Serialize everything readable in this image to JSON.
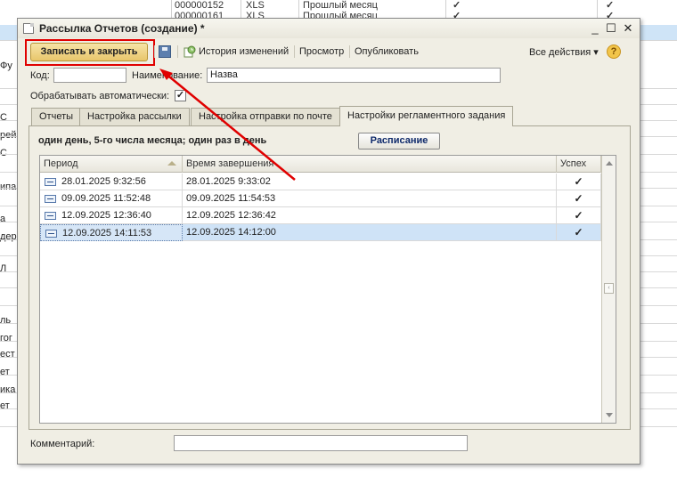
{
  "background": {
    "top_row": {
      "col1": "000000152",
      "col2": "XLS",
      "col3": "Прошлый месяц"
    },
    "second_row": {
      "col1": "000000161",
      "col2": "XLS",
      "col3": "Прошлый месяц"
    },
    "left_fragments": [
      "Фу",
      "С",
      "рей,",
      "С",
      "ипа",
      "а",
      "дер",
      "Л",
      "ль",
      "гог",
      "ест",
      "ет",
      "ика",
      "ет"
    ]
  },
  "dialog": {
    "title": "Рассылка Отчетов (создание) *",
    "window_buttons": {
      "minimize": "_",
      "maximize": "☐",
      "close": "✕"
    },
    "toolbar": {
      "save_close_label": "Записать и закрыть",
      "history_label": "История изменений",
      "preview_label": "Просмотр",
      "publish_label": "Опубликовать",
      "all_actions_label": "Все действия ▾",
      "help_label": "?"
    },
    "fields": {
      "code_label": "Код:",
      "code_value": "",
      "name_label": "Наименование:",
      "name_value": "Назва",
      "auto_label": "Обрабатывать автоматически:",
      "auto_checked": "✓"
    },
    "tabs": [
      {
        "label": "Отчеты"
      },
      {
        "label": "Настройка рассылки"
      },
      {
        "label": "Настройка отправки по почте"
      },
      {
        "label": "Настройки регламентного задания"
      }
    ],
    "schedule": {
      "description": "один день, 5-го числа месяца; один раз в день",
      "button_label": "Расписание"
    },
    "grid": {
      "headers": {
        "period": "Период",
        "end_time": "Время завершения",
        "success": "Успех"
      },
      "rows": [
        {
          "period": "28.01.2025 9:32:56",
          "end_time": "28.01.2025 9:33:02",
          "success": "✓"
        },
        {
          "period": "09.09.2025 11:52:48",
          "end_time": "09.09.2025 11:54:53",
          "success": "✓"
        },
        {
          "period": "12.09.2025 12:36:40",
          "end_time": "12.09.2025 12:36:42",
          "success": "✓"
        },
        {
          "period": "12.09.2025 14:11:53",
          "end_time": "12.09.2025 14:12:00",
          "success": "✓"
        }
      ]
    },
    "comment_label": "Комментарий:",
    "comment_value": ""
  },
  "colors": {
    "highlight": "#e00000",
    "selection": "#cfe3f7",
    "primary_button": "#e8c66b"
  }
}
